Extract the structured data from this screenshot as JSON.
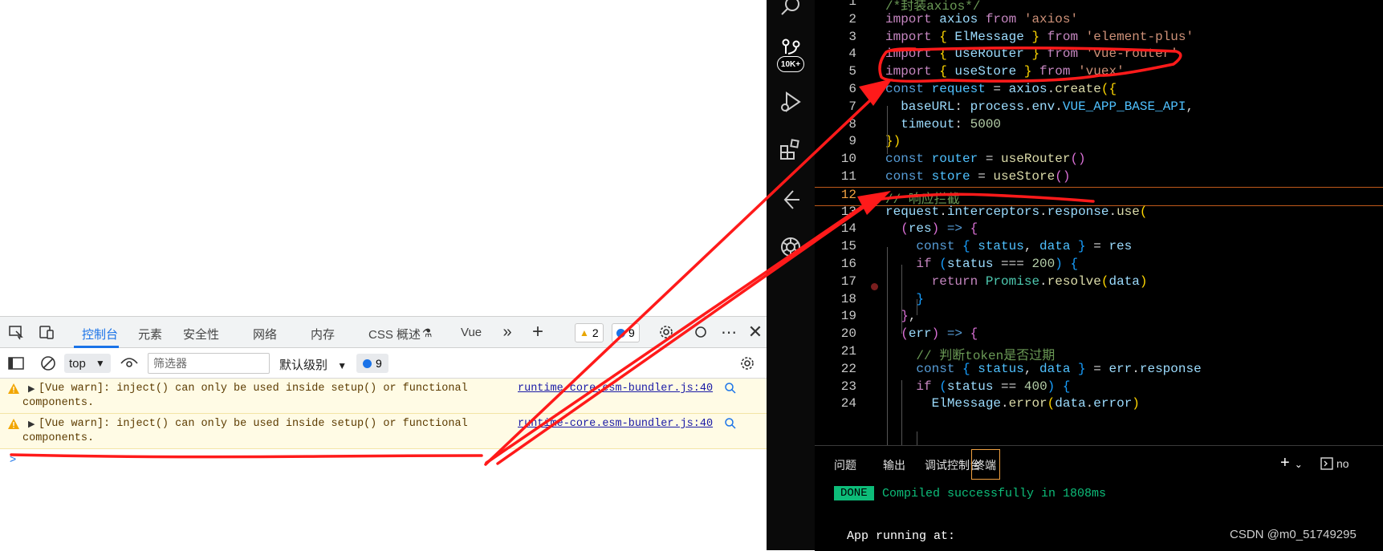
{
  "devtools": {
    "tabs": [
      "控制台",
      "元素",
      "安全性",
      "网络",
      "内存",
      "CSS 概述",
      "Vue"
    ],
    "warning_count": "2",
    "message_count": "9",
    "context": "top",
    "filter_placeholder": "筛选器",
    "level_label": "默认级别",
    "filter_message_count": "9",
    "messages": [
      {
        "line1": "[Vue warn]: inject() can only be used inside setup() or functional",
        "line2": "components.",
        "source": "runtime-core.esm-bundler.js:40"
      },
      {
        "line1": "[Vue warn]: inject() can only be used inside setup() or functional",
        "line2": "components.",
        "source": "runtime-core.esm-bundler.js:40"
      }
    ],
    "prompt": ">"
  },
  "vscode": {
    "activity_badge": "10K+",
    "line_numbers": [
      "1",
      "2",
      "3",
      "4",
      "5",
      "6",
      "7",
      "8",
      "9",
      "10",
      "11",
      "12",
      "13",
      "14",
      "15",
      "16",
      "17",
      "18",
      "19",
      "20",
      "21",
      "22",
      "23",
      "24"
    ],
    "code_segments": [
      [
        [
          "c",
          "/*封装axios*/"
        ]
      ],
      [
        [
          "k",
          "import "
        ],
        [
          "v",
          "axios "
        ],
        [
          "k",
          "from "
        ],
        [
          "s",
          "'axios'"
        ]
      ],
      [
        [
          "k",
          "import "
        ],
        [
          "p",
          "{ "
        ],
        [
          "v",
          "ElMessage "
        ],
        [
          "p",
          "} "
        ],
        [
          "k",
          "from "
        ],
        [
          "s",
          "'element-plus'"
        ]
      ],
      [
        [
          "k",
          "import "
        ],
        [
          "p",
          "{ "
        ],
        [
          "v",
          "useRouter "
        ],
        [
          "p",
          "} "
        ],
        [
          "k",
          "from "
        ],
        [
          "s",
          "'vue-router'"
        ]
      ],
      [
        [
          "k",
          "import "
        ],
        [
          "p",
          "{ "
        ],
        [
          "v",
          "useStore "
        ],
        [
          "p",
          "} "
        ],
        [
          "k",
          "from "
        ],
        [
          "s",
          "'vuex'"
        ]
      ],
      [
        [
          "kw",
          "const "
        ],
        [
          "const",
          "request "
        ],
        [
          "w",
          "= "
        ],
        [
          "v",
          "axios"
        ],
        [
          "w",
          "."
        ],
        [
          "f",
          "create"
        ],
        [
          "p",
          "({"
        ]
      ],
      [
        [
          "w",
          "  "
        ],
        [
          "v",
          "baseURL"
        ],
        [
          "w",
          ": "
        ],
        [
          "v",
          "process"
        ],
        [
          "w",
          "."
        ],
        [
          "v",
          "env"
        ],
        [
          "w",
          "."
        ],
        [
          "const",
          "VUE_APP_BASE_API"
        ],
        [
          "w",
          ","
        ]
      ],
      [
        [
          "w",
          "  "
        ],
        [
          "v",
          "timeout"
        ],
        [
          "w",
          ": "
        ],
        [
          "n",
          "5000"
        ]
      ],
      [
        [
          "p",
          "})"
        ]
      ],
      [
        [
          "kw",
          "const "
        ],
        [
          "const",
          "router "
        ],
        [
          "w",
          "= "
        ],
        [
          "f",
          "useRouter"
        ],
        [
          "pc",
          "()"
        ]
      ],
      [
        [
          "kw",
          "const "
        ],
        [
          "const",
          "store "
        ],
        [
          "w",
          "= "
        ],
        [
          "f",
          "useStore"
        ],
        [
          "pc",
          "()"
        ]
      ],
      [
        [
          "c",
          "// 响应拦截"
        ]
      ],
      [
        [
          "v",
          "request"
        ],
        [
          "w",
          "."
        ],
        [
          "v",
          "interceptors"
        ],
        [
          "w",
          "."
        ],
        [
          "v",
          "response"
        ],
        [
          "w",
          "."
        ],
        [
          "f",
          "use"
        ],
        [
          "p",
          "("
        ]
      ],
      [
        [
          "w",
          "  "
        ],
        [
          "pc",
          "("
        ],
        [
          "v",
          "res"
        ],
        [
          "pc",
          ") "
        ],
        [
          "kw",
          "=> "
        ],
        [
          "pc",
          "{"
        ]
      ],
      [
        [
          "w",
          "    "
        ],
        [
          "kw",
          "const "
        ],
        [
          "pb",
          "{ "
        ],
        [
          "const",
          "status"
        ],
        [
          "w",
          ", "
        ],
        [
          "const",
          "data "
        ],
        [
          "pb",
          "} "
        ],
        [
          "w",
          "= "
        ],
        [
          "v",
          "res"
        ]
      ],
      [
        [
          "w",
          "    "
        ],
        [
          "k",
          "if "
        ],
        [
          "pb",
          "("
        ],
        [
          "v",
          "status "
        ],
        [
          "w",
          "=== "
        ],
        [
          "n",
          "200"
        ],
        [
          "pb",
          ") "
        ],
        [
          "pb",
          "{"
        ]
      ],
      [
        [
          "w",
          "      "
        ],
        [
          "k",
          "return "
        ],
        [
          "t",
          "Promise"
        ],
        [
          "w",
          "."
        ],
        [
          "f",
          "resolve"
        ],
        [
          "p",
          "("
        ],
        [
          "v",
          "data"
        ],
        [
          "p",
          ")"
        ]
      ],
      [
        [
          "w",
          "    "
        ],
        [
          "pb",
          "}"
        ]
      ],
      [
        [
          "w",
          "  "
        ],
        [
          "pc",
          "}"
        ],
        [
          "w",
          ","
        ]
      ],
      [
        [
          "w",
          "  "
        ],
        [
          "pc",
          "("
        ],
        [
          "v",
          "err"
        ],
        [
          "pc",
          ") "
        ],
        [
          "kw",
          "=> "
        ],
        [
          "pc",
          "{"
        ]
      ],
      [
        [
          "w",
          "    "
        ],
        [
          "c",
          "// 判断token是否过期"
        ]
      ],
      [
        [
          "w",
          "    "
        ],
        [
          "kw",
          "const "
        ],
        [
          "pb",
          "{ "
        ],
        [
          "const",
          "status"
        ],
        [
          "w",
          ", "
        ],
        [
          "const",
          "data "
        ],
        [
          "pb",
          "} "
        ],
        [
          "w",
          "= "
        ],
        [
          "v",
          "err"
        ],
        [
          "w",
          "."
        ],
        [
          "v",
          "response"
        ]
      ],
      [
        [
          "w",
          "    "
        ],
        [
          "k",
          "if "
        ],
        [
          "pb",
          "("
        ],
        [
          "v",
          "status "
        ],
        [
          "w",
          "== "
        ],
        [
          "n",
          "400"
        ],
        [
          "pb",
          ") "
        ],
        [
          "pb",
          "{"
        ]
      ],
      [
        [
          "w",
          "      "
        ],
        [
          "v",
          "ElMessage"
        ],
        [
          "w",
          "."
        ],
        [
          "f",
          "error"
        ],
        [
          "p",
          "("
        ],
        [
          "v",
          "data"
        ],
        [
          "w",
          "."
        ],
        [
          "v",
          "error"
        ],
        [
          "p",
          ")"
        ]
      ]
    ],
    "panel_tabs": [
      "问题",
      "输出",
      "调试控制台",
      "终端"
    ],
    "panel_cut_label": "no",
    "done_label": "DONE",
    "compiled_message": "Compiled successfully in 1808ms",
    "app_running": "App running at:"
  },
  "watermark": "CSDN @m0_51749295",
  "colors": {
    "annotation_red": "#ff1a1a",
    "accent_blue": "#1a73e8",
    "terminal_green": "#0dbc79"
  }
}
